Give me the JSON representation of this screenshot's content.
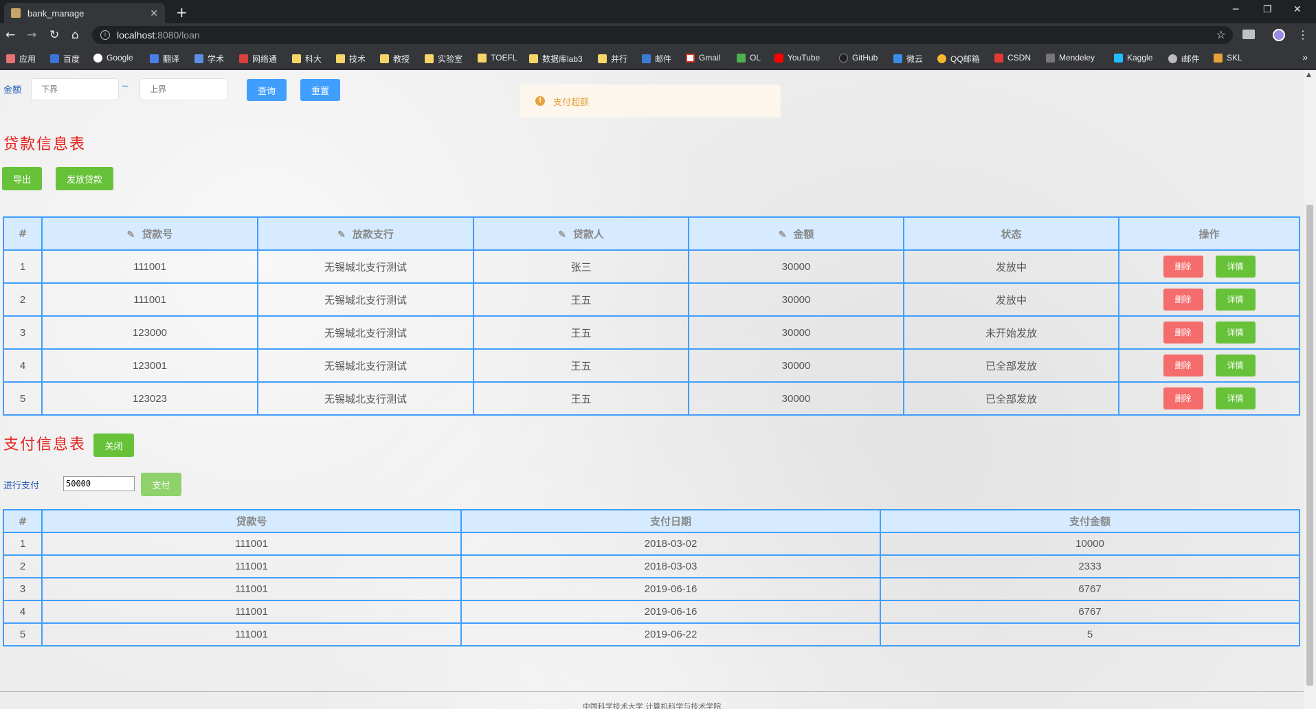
{
  "browser": {
    "tab_title": "bank_manage",
    "url_host": "localhost",
    "url_path": ":8080/loan",
    "bookmarks": [
      "应用",
      "百度",
      "Google",
      "翻译",
      "学术",
      "网络通",
      "科大",
      "技术",
      "教授",
      "实验室",
      "TOEFL",
      "数据库lab3",
      "并行",
      "邮件",
      "Gmail",
      "OL",
      "YouTube",
      "GitHub",
      "微云",
      "QQ邮箱",
      "CSDN",
      "Mendeley",
      "Kaggle",
      "i邮件",
      "SKL"
    ],
    "more": "»"
  },
  "filter": {
    "label": "金额",
    "lower_placeholder": "下界",
    "upper_placeholder": "上界",
    "tilde": "~",
    "query_label": "查询",
    "reset_label": "重置"
  },
  "alert": {
    "message": "支付超额",
    "color": "#e6a23c"
  },
  "loan_section": {
    "title": "贷款信息表",
    "export_label": "导出",
    "issue_label": "发放贷款",
    "headers": [
      "#",
      "贷款号",
      "放款支行",
      "贷款人",
      "金额",
      "状态",
      "操作"
    ],
    "rows": [
      {
        "idx": "1",
        "loan_no": "111001",
        "branch": "无锡城北支行测试",
        "borrower": "张三",
        "amount": "30000",
        "status": "发放中"
      },
      {
        "idx": "2",
        "loan_no": "111001",
        "branch": "无锡城北支行测试",
        "borrower": "王五",
        "amount": "30000",
        "status": "发放中"
      },
      {
        "idx": "3",
        "loan_no": "123000",
        "branch": "无锡城北支行测试",
        "borrower": "王五",
        "amount": "30000",
        "status": "未开始发放"
      },
      {
        "idx": "4",
        "loan_no": "123001",
        "branch": "无锡城北支行测试",
        "borrower": "王五",
        "amount": "30000",
        "status": "已全部发放"
      },
      {
        "idx": "5",
        "loan_no": "123023",
        "branch": "无锡城北支行测试",
        "borrower": "王五",
        "amount": "30000",
        "status": "已全部发放"
      }
    ],
    "delete_label": "删除",
    "detail_label": "详情"
  },
  "payment_section": {
    "title": "支付信息表",
    "close_label": "关闭",
    "pay_label": "进行支付",
    "pay_value": "50000",
    "pay_button": "支付",
    "headers": [
      "#",
      "贷款号",
      "支付日期",
      "支付金额"
    ],
    "rows": [
      {
        "idx": "1",
        "loan_no": "111001",
        "date": "2018-03-02",
        "amount": "10000"
      },
      {
        "idx": "2",
        "loan_no": "111001",
        "date": "2018-03-03",
        "amount": "2333"
      },
      {
        "idx": "3",
        "loan_no": "111001",
        "date": "2019-06-16",
        "amount": "6767"
      },
      {
        "idx": "4",
        "loan_no": "111001",
        "date": "2019-06-16",
        "amount": "6767"
      },
      {
        "idx": "5",
        "loan_no": "111001",
        "date": "2019-06-22",
        "amount": "5"
      }
    ]
  },
  "footer": {
    "text": "中国科学技术大学 计算机科学与技术学院"
  },
  "colors": {
    "accent_blue": "#409eff",
    "success_green": "#67c23a",
    "danger_red": "#f56c6c",
    "title_red": "#e8201c"
  }
}
